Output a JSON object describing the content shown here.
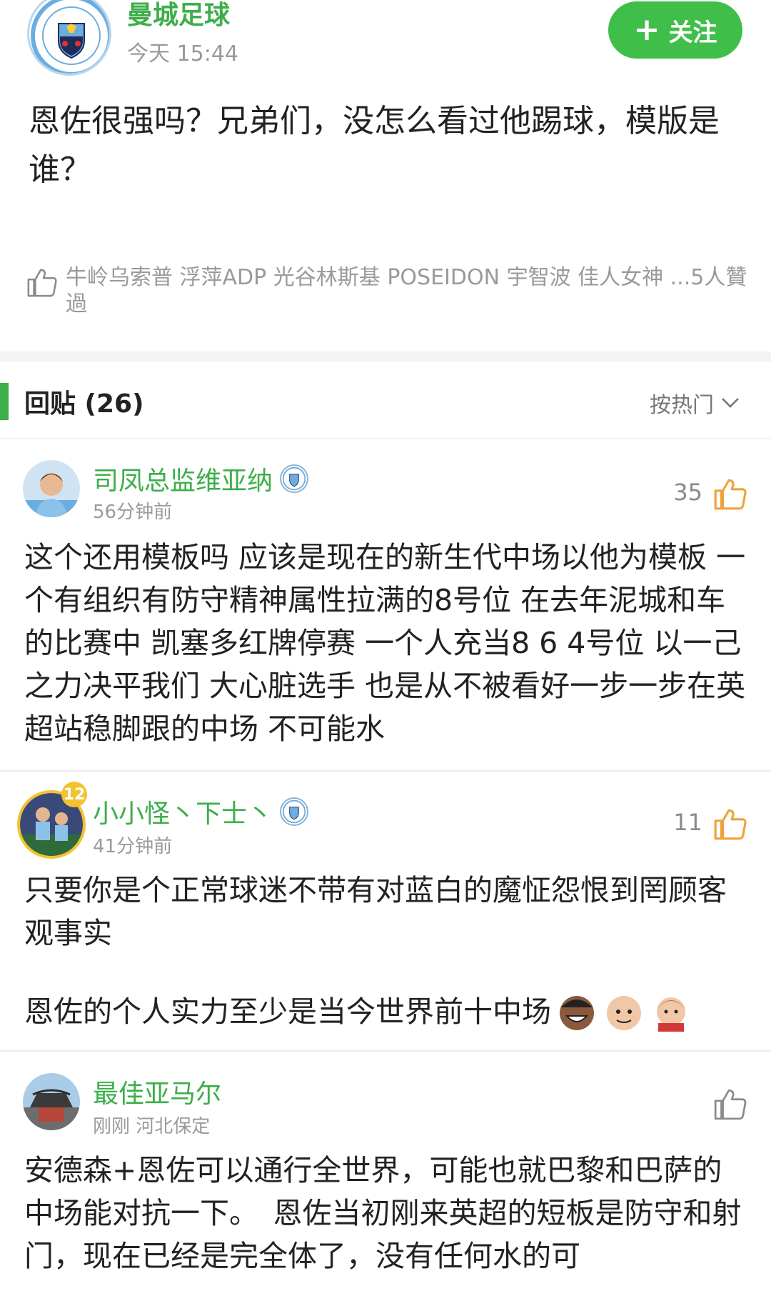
{
  "post": {
    "author": "曼城足球",
    "time": "今天 15:44",
    "follow_label": "关注",
    "body": "恩佐很强吗？兄弟们，没怎么看过他踢球，模版是谁？",
    "likers_text": "牛岭乌索普 浮萍ADP 光谷林斯基 POSEIDON 宇智波 佳人女神 ...5人贊過"
  },
  "replies": {
    "title": "回贴 (26)",
    "sort_label": "按热门"
  },
  "comments": [
    {
      "name": "司凤总监维亚纳",
      "time": "56分钟前",
      "likes": "35",
      "text": "这个还用模板吗 应该是现在的新生代中场以他为模板 一个有组织有防守精神属性拉满的8号位 在去年泥城和车的比赛中 凯塞多红牌停赛 一个人充当8 6 4号位 以一己之力决平我们 大心脏选手 也是从不被看好一步一步在英超站稳脚跟的中场 不可能水"
    },
    {
      "name": "小小怪丶下士丶",
      "time": "41分钟前",
      "likes": "11",
      "badge_number": "12",
      "text_1": "只要你是个正常球迷不带有对蓝白的魔怔怨恨到罔顾客观事实",
      "text_2": "恩佐的个人实力至少是当今世界前十中场"
    },
    {
      "name": "最佳亚马尔",
      "time": "刚刚 河北保定",
      "likes": "",
      "text": "安德森+恩佐可以通行全世界，可能也就巴黎和巴萨的中场能对抗一下。　恩佐当初刚来英超的短板是防守和射门，现在已经是完全体了，没有任何水的可"
    }
  ],
  "colors": {
    "accent_green": "#3dae4a",
    "follow_green": "#3fbf4a",
    "like_orange": "#f0a23a",
    "muted_gray": "#9a9a9a"
  }
}
